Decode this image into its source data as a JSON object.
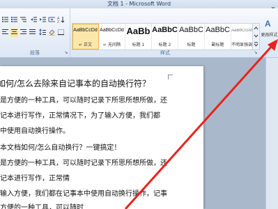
{
  "window": {
    "title": "文档 1 - Microsoft Word",
    "minimize": "—",
    "close": "✕"
  },
  "ribbon": {
    "paragraph_group_label": "段落",
    "styles_group_label": "样式",
    "styles": [
      {
        "sample": "AaBbCcDd",
        "name": "↵ 正文",
        "active": true
      },
      {
        "sample": "AaBbCcDd",
        "name": "↵ 无间隔"
      },
      {
        "sample": "AaBb",
        "name": "标题 1"
      },
      {
        "sample": "AaBbC",
        "name": "标题 2"
      },
      {
        "sample": "AaBbC",
        "name": "标题"
      },
      {
        "sample": "AaBbC",
        "name": "副标题"
      },
      {
        "sample": "AaBbCcDd",
        "name": "不明显强调"
      }
    ],
    "change_styles": {
      "icon": "A",
      "label": "更改样式"
    }
  },
  "document": {
    "heading": "如何/怎么去除来自记事本的自动换行符？",
    "lines": [
      "是方便的一种工具，可以随时记录下所思所想所做，还",
      "记本进行写作，正常情况下，为了输入方便，我们都",
      "中使用自动换行操作。",
      "本文档如何/怎么自动换行？一键搞定！",
      "是方便的一种工具，可以随时记录下所思所想所做，还",
      "记本进行写作，正常情",
      "输入方便，我们都在记事本中使用自动换行操作，记事",
      "方便的一种工具，可以随时"
    ]
  },
  "colors": {
    "arrow": "#e8231b",
    "ribbon_bg": "#dce6f4"
  }
}
